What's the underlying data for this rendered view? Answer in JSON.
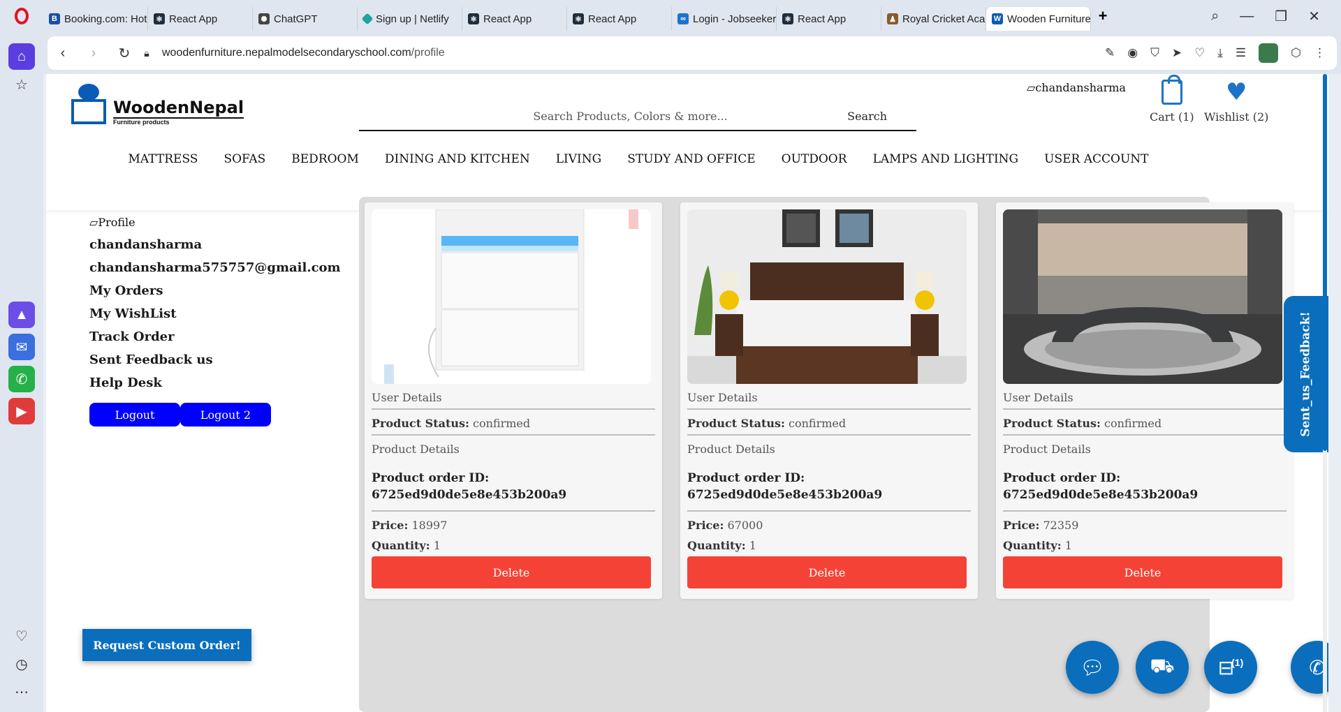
{
  "browser": {
    "tabs": [
      {
        "title": "Booking.com: Hot",
        "icon": "booking-icon",
        "color": "#1a4fa0"
      },
      {
        "title": "React App",
        "icon": "react-icon",
        "color": "#1f2d3d"
      },
      {
        "title": "ChatGPT",
        "icon": "chatgpt-icon",
        "color": "#444444"
      },
      {
        "title": "Sign up | Netlify",
        "icon": "netlify-icon",
        "color": "#20a4a0"
      },
      {
        "title": "React App",
        "icon": "react-icon",
        "color": "#1f2d3d"
      },
      {
        "title": "React App",
        "icon": "react-icon",
        "color": "#1f2d3d"
      },
      {
        "title": "Login - Jobseeker",
        "icon": "meta-icon",
        "color": "#1e73c9"
      },
      {
        "title": "React App",
        "icon": "react-icon",
        "color": "#1f2d3d"
      },
      {
        "title": "Royal Cricket Aca",
        "icon": "cricket-icon",
        "color": "#8a5a2b"
      },
      {
        "title": "Wooden Furniture Nepal |",
        "icon": "woodennepal-icon",
        "color": "#0a5bb5"
      }
    ],
    "url_host": "woodenfurniture.nepalmodelsecondaryschool.com",
    "url_path": "/profile"
  },
  "header": {
    "logo_title": "WoodenNepal",
    "logo_subtitle": "Furniture products",
    "search_placeholder": "Search Products, Colors & more...",
    "search_button": "Search",
    "user_image_alt": "chandansharma",
    "cart_label": "Cart (1)",
    "wishlist_label": "Wishlist (2)"
  },
  "nav": [
    "MATTRESS",
    "SOFAS",
    "BEDROOM",
    "DINING AND KITCHEN",
    "LIVING",
    "STUDY AND OFFICE",
    "OUTDOOR",
    "LAMPS AND LIGHTING",
    "USER ACCOUNT"
  ],
  "profile": {
    "image_alt": "Profile",
    "username": "chandansharma",
    "email": "chandansharma575757@gmail.com",
    "links": [
      "My Orders",
      "My WishList",
      "Track Order",
      "Sent Feedback us",
      "Help Desk"
    ],
    "logout": "Logout",
    "logout2": "Logout 2"
  },
  "custom_order": "Request Custom Order!",
  "feedback_tab": "Sent_us_Feedback!",
  "order_labels": {
    "user_details": "User Details",
    "status_key": "Product Status:",
    "product_details": "Product Details",
    "id_key": "Product order ID:",
    "price_key": "Price:",
    "qty_key": "Quantity:",
    "delete": "Delete"
  },
  "orders": [
    {
      "status": "confirmed",
      "order_id": "6725ed9d0de5e8e453b200a9",
      "price": "18997",
      "quantity": "1",
      "image": "white-nightstand"
    },
    {
      "status": "confirmed",
      "order_id": "6725ed9d0de5e8e453b200a9",
      "price": "67000",
      "quantity": "1",
      "image": "wooden-bed"
    },
    {
      "status": "confirmed",
      "order_id": "6725ed9d0de5e8e453b200a9",
      "price": "72359",
      "quantity": "1",
      "image": "round-sofa"
    }
  ],
  "fab_badge": "(1)",
  "colors": {
    "brand": "#0a6ebd",
    "delete": "#f44336",
    "logout": "#0000ff"
  }
}
